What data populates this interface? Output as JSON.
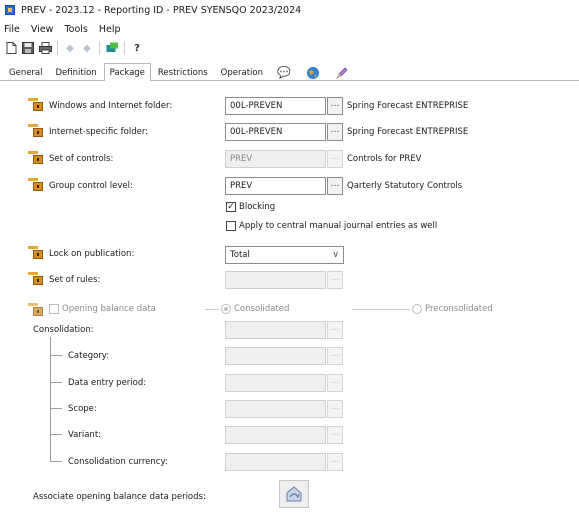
{
  "window": {
    "title": "PREV - 2023.12 - Reporting ID - PREV SYENSQO 2023/2024"
  },
  "menu": [
    "File",
    "View",
    "Tools",
    "Help"
  ],
  "toolbar": {
    "icons": [
      "new-icon",
      "save-icon",
      "print-icon",
      "back-arrow-icon",
      "forward-arrow-icon",
      "refresh-icon",
      "help-icon"
    ]
  },
  "tabs": [
    "General",
    "Definition",
    "Package",
    "Restrictions",
    "Operation"
  ],
  "tab_icons": [
    "speech-bubble-icon",
    "globe-icon",
    "pencil-icon"
  ],
  "active_tab": "Package",
  "rows": {
    "windows_folder": {
      "label": "Windows and Internet folder:",
      "value": "00L-PREVEN",
      "description": "Spring Forecast ENTREPRISE"
    },
    "internet_folder": {
      "label": "Internet-specific folder:",
      "value": "00L-PREVEN",
      "description": "Spring Forecast ENTREPRISE"
    },
    "set_of_controls": {
      "label": "Set of controls:",
      "value": "PREV",
      "description": "Controls for PREV"
    },
    "group_control": {
      "label": "Group control level:",
      "value": "PREV",
      "description": "Qarterly Statutory Controls"
    },
    "blocking": {
      "label": "Blocking",
      "checked": true
    },
    "apply_central": {
      "label": "Apply to central manual journal entries as well",
      "checked": false
    },
    "lock_on_publication": {
      "label": "Lock on publication:",
      "value": "Total"
    },
    "set_of_rules": {
      "label": "Set of rules:"
    }
  },
  "opening_balance": {
    "label": "Opening balance data",
    "checked": false,
    "radio_consolidated": "Consolidated",
    "radio_preconsolidated": "Preconsolidated",
    "selected": "Consolidated"
  },
  "consolidation": {
    "label": "Consolidation:",
    "items": [
      "Category:",
      "Data entry period:",
      "Scope:",
      "Variant:",
      "Consolidation currency:"
    ]
  },
  "associate": {
    "label": "Associate opening balance data periods:"
  }
}
